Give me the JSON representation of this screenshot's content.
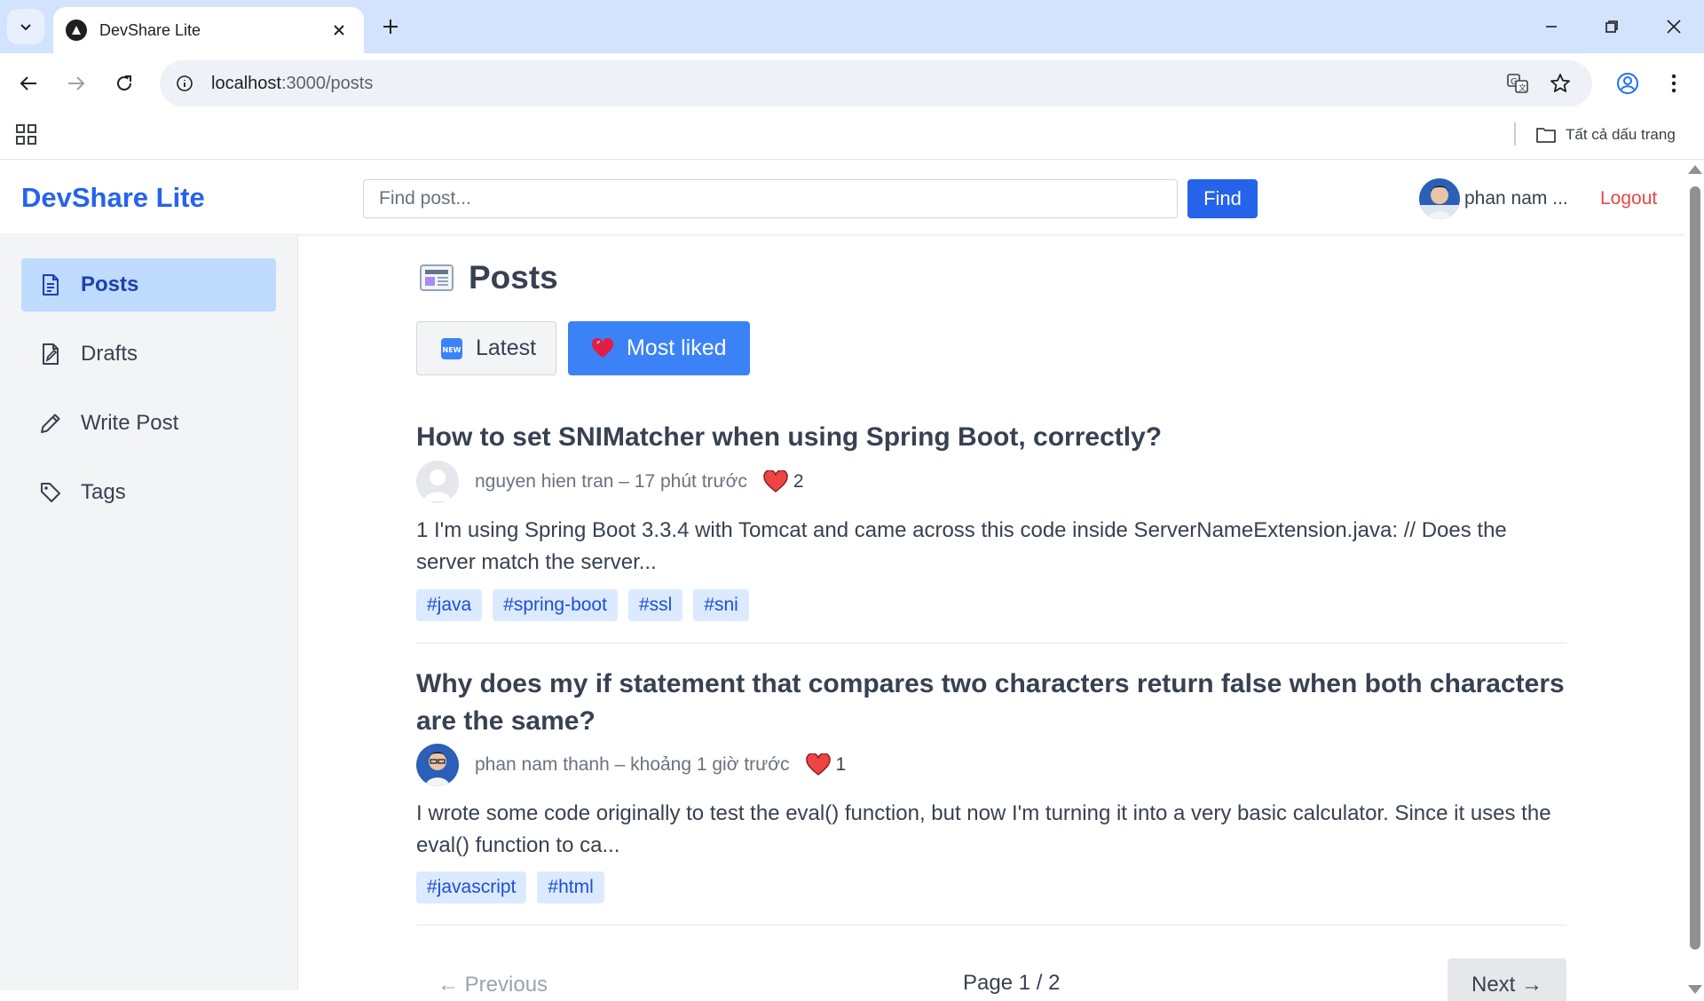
{
  "browser": {
    "tab_title": "DevShare Lite",
    "url_host": "localhost",
    "url_rest": ":3000/posts",
    "bookmarks_all": "Tất cả dấu trang"
  },
  "header": {
    "brand": "DevShare Lite",
    "search_placeholder": "Find post...",
    "find_label": "Find",
    "user_name": "phan nam ...",
    "logout_label": "Logout"
  },
  "sidebar": {
    "items": [
      {
        "label": "Posts",
        "icon": "document-icon",
        "active": true
      },
      {
        "label": "Drafts",
        "icon": "draft-icon",
        "active": false
      },
      {
        "label": "Write Post",
        "icon": "pencil-icon",
        "active": false
      },
      {
        "label": "Tags",
        "icon": "tag-icon",
        "active": false
      }
    ]
  },
  "main": {
    "title": "Posts",
    "sort": {
      "latest_label": "Latest",
      "liked_label": "Most liked",
      "active": "Most liked"
    },
    "posts": [
      {
        "title": "How to set SNIMatcher when using Spring Boot, correctly?",
        "meta": "nguyen hien tran – 17 phút trước",
        "likes": "2",
        "excerpt": "1 I'm using Spring Boot 3.3.4 with Tomcat and came across this code inside ServerNameExtension.java: // Does the server match the server...",
        "tags": [
          "#java",
          "#spring-boot",
          "#ssl",
          "#sni"
        ]
      },
      {
        "title": "Why does my if statement that compares two characters return false when both characters are the same?",
        "meta": "phan nam thanh – khoảng 1 giờ trước",
        "likes": "1",
        "excerpt": "I wrote some code originally to test the eval() function, but now I'm turning it into a very basic calculator. Since it uses the eval() function to ca...",
        "tags": [
          "#javascript",
          "#html"
        ]
      }
    ],
    "pager": {
      "prev_label": "← Previous",
      "info": "Page 1 / 2",
      "next_label": "Next →"
    }
  },
  "colors": {
    "brand": "#2563eb",
    "logout": "#ef4444",
    "active_sort": "#3b82f6",
    "tag_bg": "#dbeafe"
  }
}
